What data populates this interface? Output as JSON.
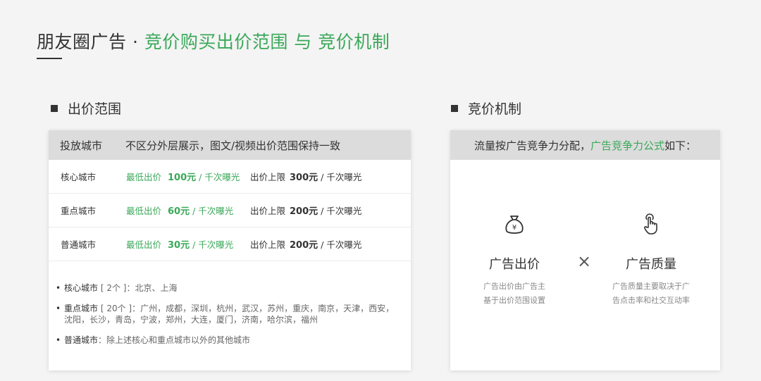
{
  "page": {
    "title_main": "朋友圈广告 · ",
    "title_accent": "竞价购买出价范围 与 竞价机制"
  },
  "left": {
    "heading": "出价范围",
    "table_head": {
      "col1": "投放城市",
      "col2": "不区分外层展示，图文/视频出价范围保持一致"
    },
    "rows": [
      {
        "city": "核心城市",
        "min_label": "最低出价",
        "min_amount": "100元",
        "min_unit": " / 千次曝光",
        "max_label": "出价上限",
        "max_amount": "300元",
        "max_unit": " / 千次曝光"
      },
      {
        "city": "重点城市",
        "min_label": "最低出价",
        "min_amount": "60元",
        "min_unit": " / 千次曝光",
        "max_label": "出价上限",
        "max_amount": "200元",
        "max_unit": " / 千次曝光"
      },
      {
        "city": "普通城市",
        "min_label": "最低出价",
        "min_amount": "30元",
        "min_unit": " / 千次曝光",
        "max_label": "出价上限",
        "max_amount": "200元",
        "max_unit": " / 千次曝光"
      }
    ],
    "notes": [
      {
        "name": "核心城市",
        "text": " [ 2个 ]：北京、上海"
      },
      {
        "name": "重点城市",
        "text": " [ 20个 ]：广州，成都，深圳，杭州，武汉，苏州，重庆，南京，天津，西安，沈阳，长沙，青岛，宁波，郑州，大连，厦门，济南，哈尔滨，福州"
      },
      {
        "name": "普通城市",
        "text": "：除上述核心和重点城市以外的其他城市"
      }
    ]
  },
  "right": {
    "heading": "竞价机制",
    "head_text": "流量按广告竞争力分配，",
    "head_accent": "广告竞争力公式",
    "head_tail": "如下：",
    "bid": {
      "label": "广告出价",
      "desc1": "广告出价由广告主",
      "desc2": "基于出价范围设置",
      "icon": "money-bag-icon"
    },
    "times": "×",
    "quality": {
      "label": "广告质量",
      "desc1": "广告质量主要取决于广",
      "desc2": "告点击率和社交互动率",
      "icon": "tap-hand-icon"
    }
  },
  "colors": {
    "accent": "#3aa859",
    "header_bg": "#dcdcdc"
  }
}
